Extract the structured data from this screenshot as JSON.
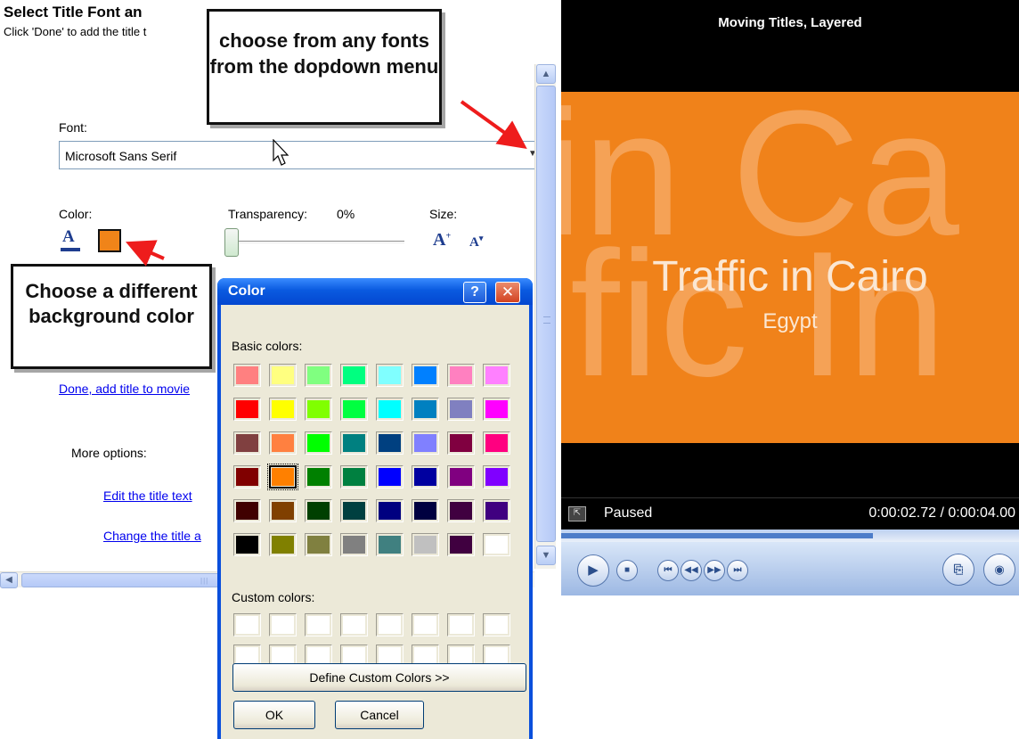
{
  "left_pane": {
    "title": "Select Title Font an",
    "subtitle": "Click 'Done' to add the title t",
    "font_label": "Font:",
    "font_value": "Microsoft Sans Serif",
    "color_label": "Color:",
    "transparency_label": "Transparency:",
    "transparency_value": "0%",
    "size_label": "Size:",
    "size_increase_glyph": "A",
    "size_decrease_glyph": "A",
    "done_link": "Done, add title to movie",
    "more_options_label": "More options:",
    "edit_text_link": "Edit the title text",
    "change_title_link": "Change the title a",
    "selected_bg_color": "#f08419"
  },
  "callouts": {
    "font_dropdown": "choose from any fonts from the dopdown menu",
    "bg_color": "Choose a different background color"
  },
  "color_dialog": {
    "title": "Color",
    "help_label": "?",
    "close_label": "✕",
    "basic_colors_label": "Basic colors:",
    "custom_colors_label": "Custom colors:",
    "define_custom_label": "Define Custom Colors >>",
    "ok_label": "OK",
    "cancel_label": "Cancel",
    "selected_index": 25,
    "basic_colors": [
      "#ff8080",
      "#ffff80",
      "#80ff80",
      "#00ff80",
      "#80ffff",
      "#0080ff",
      "#ff80c0",
      "#ff80ff",
      "#ff0000",
      "#ffff00",
      "#80ff00",
      "#00ff40",
      "#00ffff",
      "#0080c0",
      "#8080c0",
      "#ff00ff",
      "#804040",
      "#ff8040",
      "#00ff00",
      "#008080",
      "#004080",
      "#8080ff",
      "#800040",
      "#ff0080",
      "#800000",
      "#ff8000",
      "#008000",
      "#008040",
      "#0000ff",
      "#0000a0",
      "#800080",
      "#8000ff",
      "#400000",
      "#804000",
      "#004000",
      "#004040",
      "#000080",
      "#000040",
      "#400040",
      "#400080",
      "#000000",
      "#808000",
      "#808040",
      "#808080",
      "#408080",
      "#c0c0c0",
      "#400040",
      "#ffffff"
    ],
    "custom_colors_count": 16
  },
  "player": {
    "title": "Moving Titles, Layered",
    "video_title": "Traffic in Cairo",
    "video_subtitle": "Egypt",
    "background_text_top": "in Ca",
    "background_text_bottom": "fic In",
    "status": "Paused",
    "time": "0:00:02.72 / 0:00:04.00",
    "progress_fraction": 0.68,
    "video_bg_color": "#f0821a"
  }
}
